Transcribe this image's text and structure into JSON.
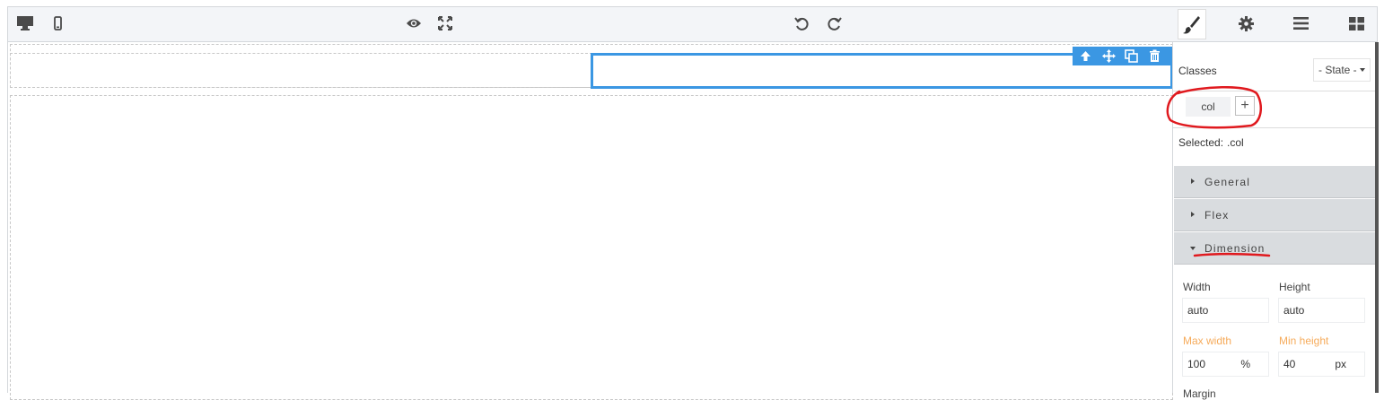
{
  "topbar": {
    "left_icons": [
      "desktop-icon",
      "mobile-icon"
    ],
    "center_icons": [
      "eye-icon",
      "fullscreen-icon",
      "undo-icon",
      "redo-icon"
    ],
    "right_icons": [
      "paint-brush-icon",
      "gear-icon",
      "layers-menu-icon",
      "blocks-grid-icon"
    ]
  },
  "canvas": {
    "toolbar_icons": [
      "arrow-up-icon",
      "move-icon",
      "clone-icon",
      "trash-icon"
    ],
    "selection_color": "#3b97e3"
  },
  "panel": {
    "classes_label": "Classes",
    "state_label": "- State -",
    "class_tag": "col",
    "add_label": "+",
    "selected_label": "Selected:",
    "selected_value": ".col",
    "sectors": [
      {
        "label": "General",
        "open": false
      },
      {
        "label": "Flex",
        "open": false
      },
      {
        "label": "Dimension",
        "open": true
      }
    ],
    "dimension": {
      "width_label": "Width",
      "width_value": "auto",
      "height_label": "Height",
      "height_value": "auto",
      "max_width_label": "Max width",
      "max_width_value": "100",
      "max_width_unit": "%",
      "min_height_label": "Min height",
      "min_height_value": "40",
      "min_height_unit": "px",
      "margin_label": "Margin"
    }
  },
  "colors": {
    "accent": "#3b97e3",
    "modified_property": "#f6ab5b",
    "annotation": "#e0191e"
  }
}
